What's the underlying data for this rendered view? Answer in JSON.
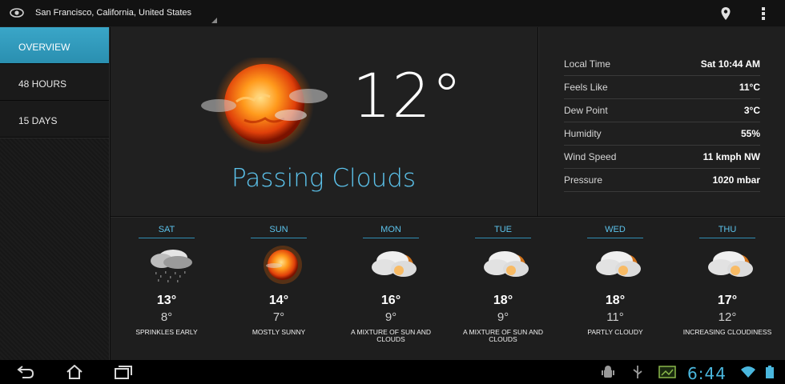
{
  "header": {
    "location": "San Francisco, California, United States"
  },
  "sidebar": {
    "items": [
      {
        "label": "OVERVIEW",
        "active": true
      },
      {
        "label": "48 HOURS",
        "active": false
      },
      {
        "label": "15 DAYS",
        "active": false
      }
    ]
  },
  "current": {
    "temperature": "12°",
    "condition": "Passing Clouds",
    "icon": "sun-with-clouds-icon"
  },
  "details": [
    {
      "label": "Local Time",
      "value": "Sat 10:44 AM"
    },
    {
      "label": "Feels Like",
      "value": "11°C"
    },
    {
      "label": "Dew Point",
      "value": "3°C"
    },
    {
      "label": "Humidity",
      "value": "55%"
    },
    {
      "label": "Wind Speed",
      "value": "11 kmph NW"
    },
    {
      "label": "Pressure",
      "value": "1020 mbar"
    }
  ],
  "forecast": [
    {
      "day": "SAT",
      "high": "13°",
      "low": "8°",
      "desc": "SPRINKLES EARLY",
      "icon": "drizzle-icon"
    },
    {
      "day": "SUN",
      "high": "14°",
      "low": "7°",
      "desc": "MOSTLY SUNNY",
      "icon": "sun-icon"
    },
    {
      "day": "MON",
      "high": "16°",
      "low": "9°",
      "desc": "A MIXTURE OF SUN AND CLOUDS",
      "icon": "sun-behind-cloud-icon"
    },
    {
      "day": "TUE",
      "high": "18°",
      "low": "9°",
      "desc": "A MIXTURE OF SUN AND CLOUDS",
      "icon": "sun-behind-cloud-icon"
    },
    {
      "day": "WED",
      "high": "18°",
      "low": "11°",
      "desc": "PARTLY CLOUDY",
      "icon": "sun-behind-cloud-icon"
    },
    {
      "day": "THU",
      "high": "17°",
      "low": "12°",
      "desc": "INCREASING CLOUDINESS",
      "icon": "sun-behind-cloud-icon"
    }
  ],
  "system": {
    "clock": "6:44",
    "accent": "#4ab7de"
  },
  "colors": {
    "accent_blue": "#5cc3ec",
    "active_tab": "#33a3c6"
  }
}
